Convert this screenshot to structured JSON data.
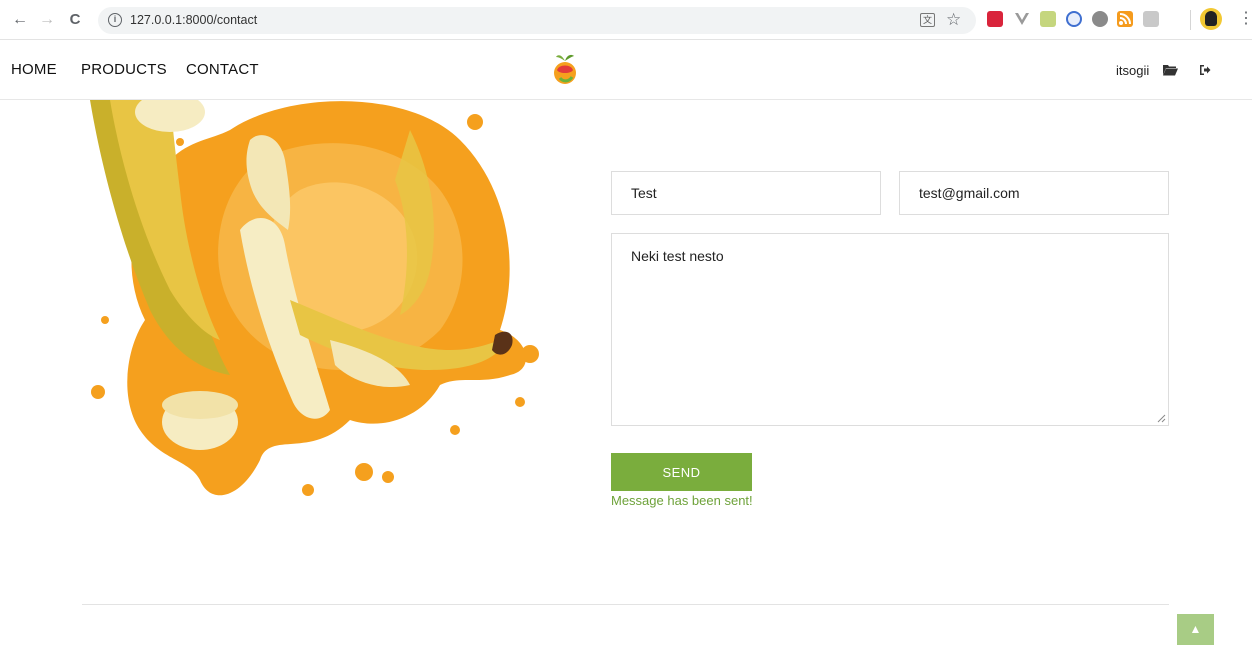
{
  "browser": {
    "url": "127.0.0.1:8000/contact",
    "back_glyph": "←",
    "forward_glyph": "→",
    "reload_glyph": "C",
    "info_glyph": "i",
    "translate_glyph": "文",
    "star_glyph": "☆",
    "menu_glyph": "⋮"
  },
  "header": {
    "nav": [
      {
        "label": "HOME"
      },
      {
        "label": "PRODUCTS"
      },
      {
        "label": "CONTACT"
      }
    ],
    "username": "itsogii"
  },
  "form": {
    "name_value": "Test",
    "email_value": "test@gmail.com",
    "message_value": "Neki test nesto",
    "send_label": "SEND",
    "success_message": "Message has been sent!"
  },
  "footer": {
    "back_to_top_glyph": "▲"
  },
  "colors": {
    "accent": "#7aad3d",
    "success_text": "#6ea23a",
    "back_to_top": "#a8cc85",
    "juice_orange": "#f5a01e",
    "banana_yellow": "#e8c544"
  }
}
